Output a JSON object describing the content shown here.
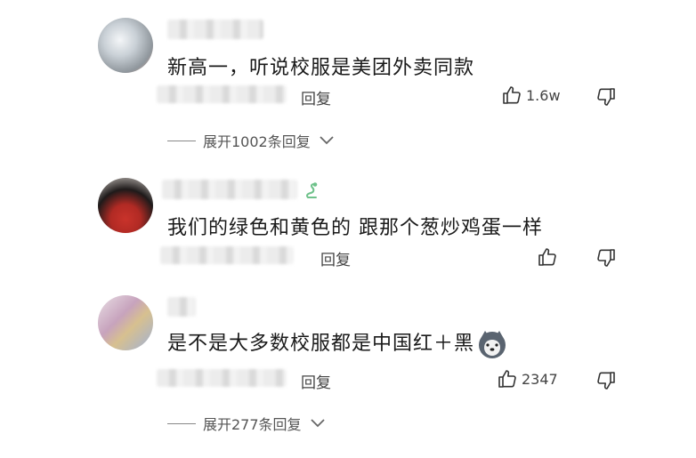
{
  "comments": [
    {
      "text": "新高一，听说校服是美团外卖同款",
      "reply_label": "回复",
      "likes": "1.6w",
      "expand_label": "展开1002条回复"
    },
    {
      "text": "我们的绿色和黄色的 跟那个葱炒鸡蛋一样",
      "reply_label": "回复",
      "likes": "",
      "expand_label": ""
    },
    {
      "text": "是不是大多数校服都是中国红＋黑",
      "reply_label": "回复",
      "likes": "2347",
      "expand_label": "展开277条回复"
    }
  ],
  "icons": {
    "like": "thumbs-up-icon",
    "dislike": "thumbs-down-icon",
    "expand": "chevron-down-icon",
    "badge": "snake-badge-icon",
    "emoji": "husky-emoji-icon"
  }
}
